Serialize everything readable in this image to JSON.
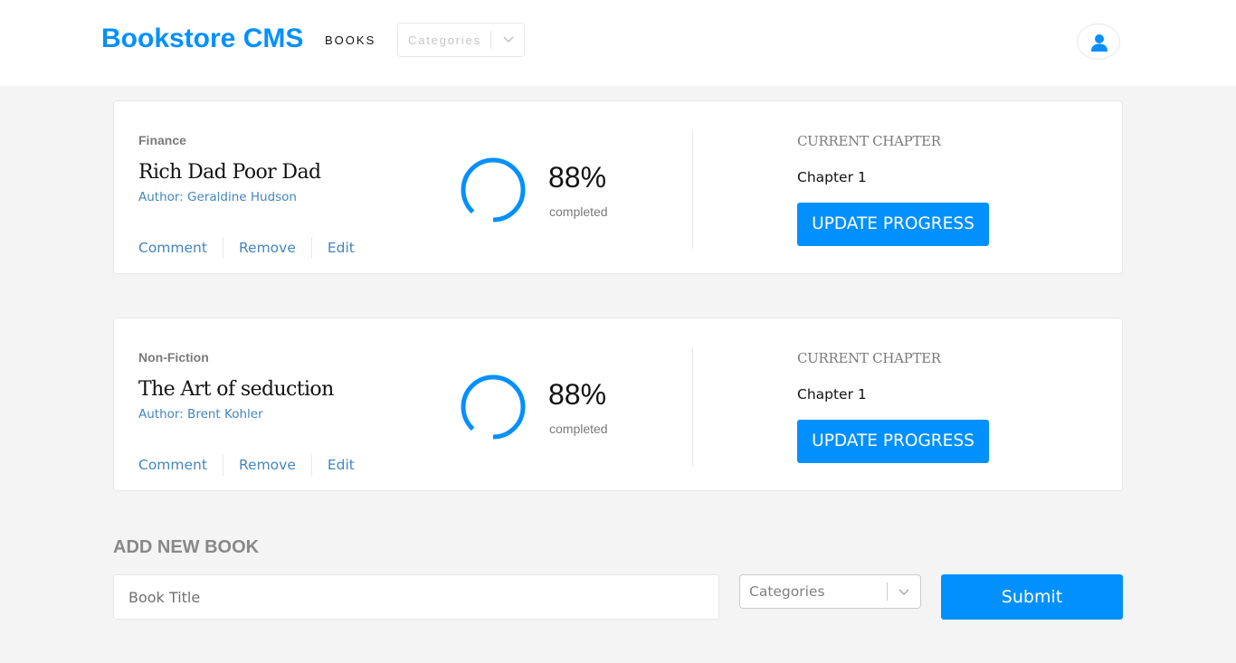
{
  "header": {
    "brand": "Bookstore CMS",
    "nav_books": "BOOKS",
    "categories_placeholder": "Categories",
    "accent_color": "#0290ff",
    "user_icon": "user-icon"
  },
  "books": [
    {
      "category": "Finance",
      "title": "Rich Dad Poor Dad",
      "author": "Author: Geraldine Hudson",
      "actions": {
        "comment": "Comment",
        "remove": "Remove",
        "edit": "Edit"
      },
      "progress_percent": 88,
      "progress_label": "88%",
      "completed_label": "completed",
      "current_chapter_label": "CURRENT CHAPTER",
      "current_chapter": "Chapter 1",
      "update_button": "UPDATE PROGRESS"
    },
    {
      "category": "Non-Fiction",
      "title": "The Art of seduction",
      "author": "Author: Brent Kohler",
      "actions": {
        "comment": "Comment",
        "remove": "Remove",
        "edit": "Edit"
      },
      "progress_percent": 88,
      "progress_label": "88%",
      "completed_label": "completed",
      "current_chapter_label": "CURRENT CHAPTER",
      "current_chapter": "Chapter 1",
      "update_button": "UPDATE PROGRESS"
    }
  ],
  "add_book": {
    "heading": "ADD NEW BOOK",
    "title_placeholder": "Book Title",
    "categories_placeholder": "Categories",
    "submit": "Submit"
  }
}
